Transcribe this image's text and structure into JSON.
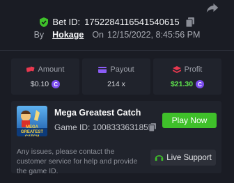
{
  "header": {
    "bet_id_label": "Bet ID:",
    "bet_id": "1752284116541540615",
    "by_label": "By",
    "username": "Hokage",
    "on_label": "On",
    "datetime": "12/15/2022, 8:45:56 PM"
  },
  "stats": [
    {
      "label": "Amount",
      "value": "$0.10",
      "icon": "dice-icon",
      "color": "#e8384f"
    },
    {
      "label": "Payout",
      "value": "214 x",
      "icon": "wallet-icon",
      "color": "#8b5cf6"
    },
    {
      "label": "Profit",
      "value": "$21.30",
      "icon": "stack-icon",
      "color": "#e8384f"
    }
  ],
  "game": {
    "title": "Mega Greatest Catch",
    "id_label": "Game ID:",
    "id": "1008333631855",
    "thumbnail_text": "MEGA GREATEST CATCH",
    "play_label": "Play Now"
  },
  "help": {
    "text": "Any issues, please contact the customer service for help and provide the game ID.",
    "support_label": "Live Support"
  },
  "colors": {
    "background": "#1a1c24",
    "card": "#20232c",
    "accent_green": "#3fc02a",
    "profit_green": "#5fe34d",
    "coin_purple": "#7c4df0"
  }
}
